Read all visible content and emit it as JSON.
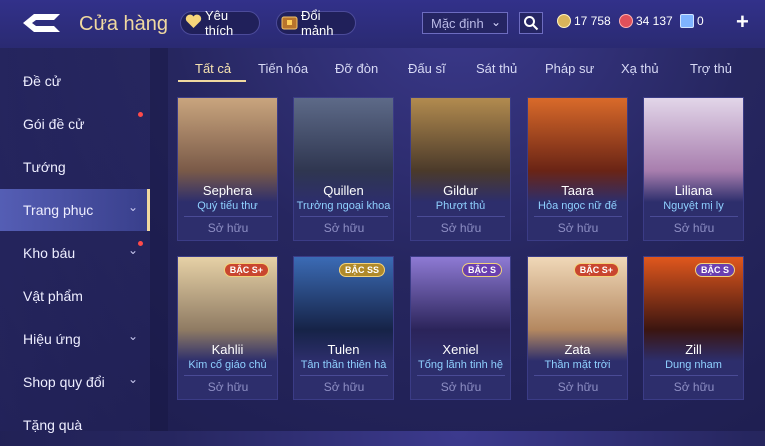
{
  "header": {
    "title": "Cửa hàng",
    "favorite_label": "Yêu thích",
    "exchange_label": "Đổi mảnh",
    "sort_label": "Mặc định",
    "gold": "17 758",
    "gems": "34 137",
    "vouchers": "0"
  },
  "sidebar": {
    "items": [
      {
        "label": "Đề cử",
        "chevron": false,
        "dot": false
      },
      {
        "label": "Gói đề cử",
        "chevron": false,
        "dot": true
      },
      {
        "label": "Tướng",
        "chevron": false,
        "dot": false
      },
      {
        "label": "Trang phục",
        "chevron": true,
        "dot": false,
        "active": true
      },
      {
        "label": "Kho báu",
        "chevron": true,
        "dot": true
      },
      {
        "label": "Vật phẩm",
        "chevron": false,
        "dot": false
      },
      {
        "label": "Hiệu ứng",
        "chevron": true,
        "dot": false
      },
      {
        "label": "Shop quy đổi",
        "chevron": true,
        "dot": false
      },
      {
        "label": "Tặng quà",
        "chevron": false,
        "dot": false
      }
    ]
  },
  "tabs": [
    "Tất cả",
    "Tiến hóa",
    "Đỡ đòn",
    "Đấu sĩ",
    "Sát thủ",
    "Pháp sư",
    "Xạ thủ",
    "Trợ thủ"
  ],
  "owned_label": "Sở hữu",
  "cards": [
    {
      "hero": "Sephera",
      "skin": "Quý tiểu thư",
      "badge": "",
      "colors": [
        "#c9a57e",
        "#7a5a48"
      ]
    },
    {
      "hero": "Quillen",
      "skin": "Trưởng ngoại khoa",
      "badge": "",
      "colors": [
        "#5d6a88",
        "#2f3650"
      ]
    },
    {
      "hero": "Gildur",
      "skin": "Phượt thủ",
      "badge": "",
      "colors": [
        "#b28b4f",
        "#4b3a2a"
      ]
    },
    {
      "hero": "Taara",
      "skin": "Hỏa ngọc nữ đế",
      "badge": "",
      "colors": [
        "#d96a2a",
        "#6a2415"
      ]
    },
    {
      "hero": "Liliana",
      "skin": "Nguyệt mị ly",
      "badge": "",
      "colors": [
        "#e2d6e9",
        "#a87eae"
      ]
    },
    {
      "hero": "Kahlii",
      "skin": "Kim cổ giáo chủ",
      "badge": "BẬC S+",
      "colors": [
        "#e6d1a6",
        "#8f7b63"
      ]
    },
    {
      "hero": "Tulen",
      "skin": "Tân thần thiên hà",
      "badge": "BẬC SS",
      "colors": [
        "#3b6bb5",
        "#162347"
      ]
    },
    {
      "hero": "Xeniel",
      "skin": "Tổng lãnh tinh hệ",
      "badge": "BẬC S",
      "colors": [
        "#8e7ad4",
        "#2b245a"
      ]
    },
    {
      "hero": "Zata",
      "skin": "Thần mặt trời",
      "badge": "BẬC S+",
      "colors": [
        "#f0d8b8",
        "#b48860"
      ]
    },
    {
      "hero": "Zill",
      "skin": "Dung nham",
      "badge": "BẬC S",
      "colors": [
        "#e0571d",
        "#3b1510"
      ]
    }
  ]
}
